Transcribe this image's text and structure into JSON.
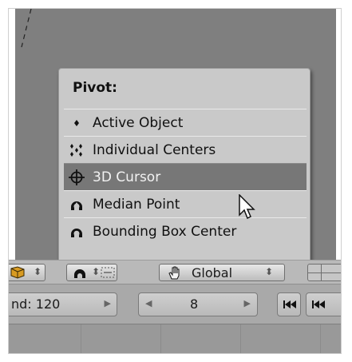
{
  "pivot_menu": {
    "title": "Pivot:",
    "items": [
      {
        "label": "Active Object",
        "icon": "active-object-icon"
      },
      {
        "label": "Individual Centers",
        "icon": "individual-centers-icon"
      },
      {
        "label": "3D Cursor",
        "icon": "3d-cursor-icon",
        "selected": true
      },
      {
        "label": "Median Point",
        "icon": "median-point-icon"
      },
      {
        "label": "Bounding Box Center",
        "icon": "bounding-box-center-icon"
      }
    ]
  },
  "header_toolbar": {
    "orientation_value": "Global"
  },
  "timeline_controls": {
    "end_frame_text": "nd: 120",
    "current_frame": "8"
  },
  "colors": {
    "viewport_bg": "#7f7f7f",
    "menu_bg": "#c9c9c9",
    "menu_highlight": "#777777",
    "toolbar_bg": "#b9b9b9"
  }
}
